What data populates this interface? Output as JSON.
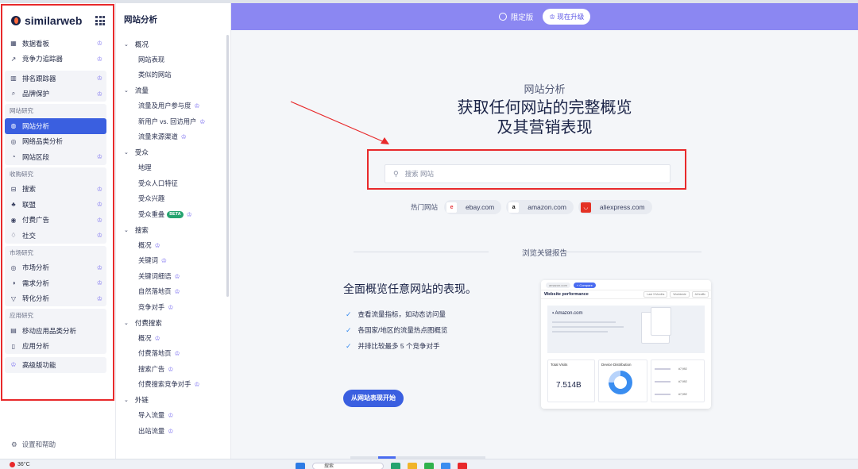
{
  "brand": {
    "name": "similarweb"
  },
  "leftnav": {
    "top_items": [
      {
        "icon": "dashboard-icon",
        "glyph": "▦",
        "label": "数据看板",
        "crown": true
      },
      {
        "icon": "trend-icon",
        "glyph": "↗",
        "label": "竞争力追踪器",
        "crown": true
      }
    ],
    "mid_items": [
      {
        "icon": "bar-chart-icon",
        "glyph": "▥",
        "label": "排名跟踪器",
        "crown": true
      },
      {
        "icon": "shield-search-icon",
        "glyph": "⌕",
        "label": "品牌保护",
        "crown": true
      }
    ],
    "groups": [
      {
        "label": "网站研究",
        "items": [
          {
            "icon": "globe-icon",
            "glyph": "◍",
            "label": "网站分析",
            "crown": false,
            "active": true
          },
          {
            "icon": "category-icon",
            "glyph": "◎",
            "label": "网络品类分析",
            "crown": false,
            "active": false
          },
          {
            "icon": "segment-icon",
            "glyph": "◔",
            "label": "网站区段",
            "crown": true,
            "active": false
          }
        ]
      },
      {
        "label": "收购研究",
        "items": [
          {
            "icon": "search-icon",
            "glyph": "⊟",
            "label": "搜索",
            "crown": true
          },
          {
            "icon": "affiliate-icon",
            "glyph": "♣",
            "label": "联盟",
            "crown": true
          },
          {
            "icon": "paid-ads-icon",
            "glyph": "◉",
            "label": "付费广告",
            "crown": true
          },
          {
            "icon": "thumb-up-icon",
            "glyph": "♢",
            "label": "社交",
            "crown": true
          }
        ]
      },
      {
        "label": "市场研究",
        "items": [
          {
            "icon": "market-icon",
            "glyph": "◎",
            "label": "市场分析",
            "crown": true
          },
          {
            "icon": "demand-icon",
            "glyph": "◑",
            "label": "需求分析",
            "crown": true
          },
          {
            "icon": "funnel-icon",
            "glyph": "▽",
            "label": "转化分析",
            "crown": true
          }
        ]
      },
      {
        "label": "应用研究",
        "items": [
          {
            "icon": "mobile-app-icon",
            "glyph": "▤",
            "label": "移动应用品类分析",
            "crown": false
          },
          {
            "icon": "app-icon",
            "glyph": "▯",
            "label": "应用分析",
            "crown": false
          }
        ]
      }
    ],
    "premium": {
      "label": "高级版功能"
    },
    "settings": {
      "label": "设置和帮助"
    }
  },
  "subnav": {
    "title": "网站分析",
    "sections": [
      {
        "label": "概况",
        "items": [
          {
            "label": "网站表现",
            "crown": false
          },
          {
            "label": "类似的网站",
            "crown": false
          }
        ]
      },
      {
        "label": "流量",
        "items": [
          {
            "label": "流量及用户参与度",
            "crown": true
          },
          {
            "label": "新用户 vs. 回访用户",
            "crown": true
          },
          {
            "label": "流量来源渠道",
            "crown": true
          }
        ]
      },
      {
        "label": "受众",
        "items": [
          {
            "label": "地理",
            "crown": false
          },
          {
            "label": "受众人口特征",
            "crown": false
          },
          {
            "label": "受众兴趣",
            "crown": false
          },
          {
            "label": "受众重叠",
            "crown": true,
            "beta": "BETA"
          }
        ]
      },
      {
        "label": "搜索",
        "items": [
          {
            "label": "概况",
            "crown": true
          },
          {
            "label": "关键词",
            "crown": true
          },
          {
            "label": "关键词细语",
            "crown": true
          },
          {
            "label": "自然落地页",
            "crown": true
          },
          {
            "label": "竞争对手",
            "crown": true
          }
        ]
      },
      {
        "label": "付费搜索",
        "items": [
          {
            "label": "概况",
            "crown": true
          },
          {
            "label": "付费落地页",
            "crown": true
          },
          {
            "label": "搜索广告",
            "crown": true
          },
          {
            "label": "付费搜索竞争对手",
            "crown": true
          }
        ]
      },
      {
        "label": "外链",
        "items": [
          {
            "label": "导入流量",
            "crown": true
          },
          {
            "label": "出站流量",
            "crown": true
          }
        ]
      }
    ]
  },
  "banner": {
    "badge": "限定版",
    "upgrade": "现在升级"
  },
  "hero": {
    "subtitle": "网站分析",
    "title_line1": "获取任何网站的完整概览",
    "title_line2": "及其营销表现",
    "search_placeholder": "搜索 网站"
  },
  "popular": {
    "label": "热门网站",
    "sites": [
      {
        "name": "ebay.com",
        "icon": "ebay-icon",
        "glyph": "e",
        "color": "#e53238",
        "bg": "#fff"
      },
      {
        "name": "amazon.com",
        "icon": "amazon-icon",
        "glyph": "a",
        "color": "#111",
        "bg": "#fff"
      },
      {
        "name": "aliexpress.com",
        "icon": "aliexpress-icon",
        "glyph": "◡",
        "color": "#fff",
        "bg": "#e43225"
      }
    ]
  },
  "reports": {
    "label": "浏览关键报告"
  },
  "feature": {
    "title": "全面概览任意网站的表现。",
    "bullets": [
      "查看流量指标，如动态访问量",
      "各国家/地区的流量热点图概览",
      "并排比较最多 5 个竞争对手"
    ],
    "cta": "从网站表现开始"
  },
  "preview": {
    "domain_chip": "amazon.com",
    "tag": "+ Compare",
    "heading": "Website performance",
    "controls": [
      "Last 3 Months",
      "Worldwide",
      "All traffic"
    ],
    "site": "Amazon.com",
    "card1_title": "Total Visits",
    "card1_value": "7.514B",
    "card2_title": "Device Distribution",
    "ranks": [
      "#7,992",
      "#7,992",
      "#7,992"
    ]
  },
  "taskbar": {
    "temp": "36°C",
    "search": "搜索"
  },
  "colors": {
    "accent": "#3a5fe0",
    "banner": "#8b87f2",
    "crown": "#7b6ff0",
    "annotation": "#e8292b"
  }
}
